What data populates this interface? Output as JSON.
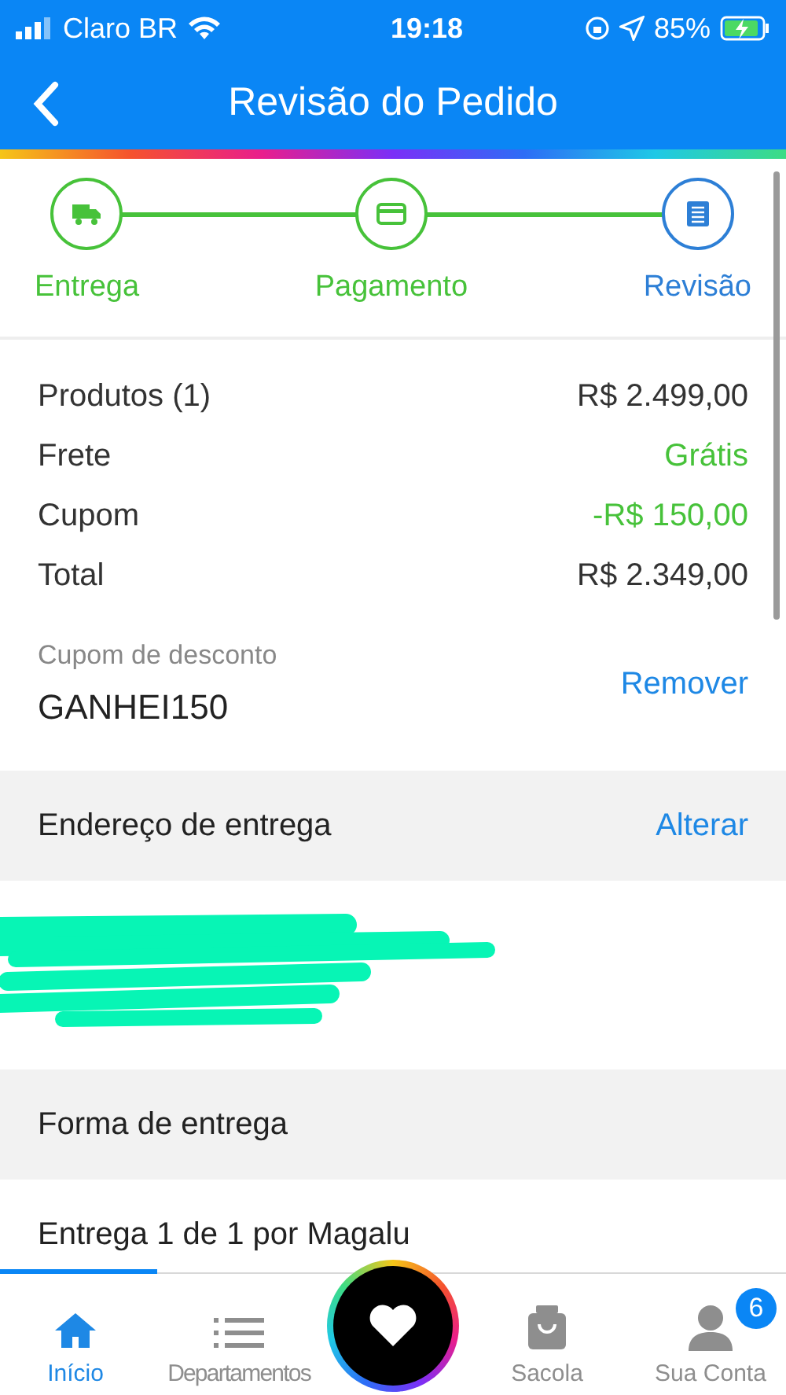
{
  "status_bar": {
    "carrier": "Claro BR",
    "time": "19:18",
    "battery": "85%"
  },
  "header": {
    "title": "Revisão do Pedido"
  },
  "steps": [
    {
      "label": "Entrega",
      "kind": "truck",
      "selected": false
    },
    {
      "label": "Pagamento",
      "kind": "card",
      "selected": false
    },
    {
      "label": "Revisão",
      "kind": "doc",
      "selected": true
    }
  ],
  "summary": [
    {
      "label": "Produtos (1)",
      "value": "R$ 2.499,00",
      "kind": "normal"
    },
    {
      "label": "Frete",
      "value": "Grátis",
      "kind": "green"
    },
    {
      "label": "Cupom",
      "value": "-R$ 150,00",
      "kind": "green"
    },
    {
      "label": "Total",
      "value": "R$ 2.349,00",
      "kind": "total"
    }
  ],
  "coupon": {
    "label": "Cupom de desconto",
    "code": "GANHEI150",
    "action": "Remover"
  },
  "address": {
    "title": "Endereço de entrega",
    "action": "Alterar"
  },
  "delivery": {
    "title": "Forma de entrega",
    "item": "Entrega 1 de 1 por Magalu"
  },
  "tab_bar": [
    {
      "label": "Início",
      "kind": "home",
      "selected": true
    },
    {
      "label": "Departamentos",
      "kind": "list",
      "selected": false
    },
    {
      "kind": "heart",
      "selected": false
    },
    {
      "label": "Sacola",
      "kind": "bag",
      "selected": false
    },
    {
      "label": "Sua Conta",
      "kind": "user",
      "selected": false,
      "badge": "6"
    }
  ]
}
